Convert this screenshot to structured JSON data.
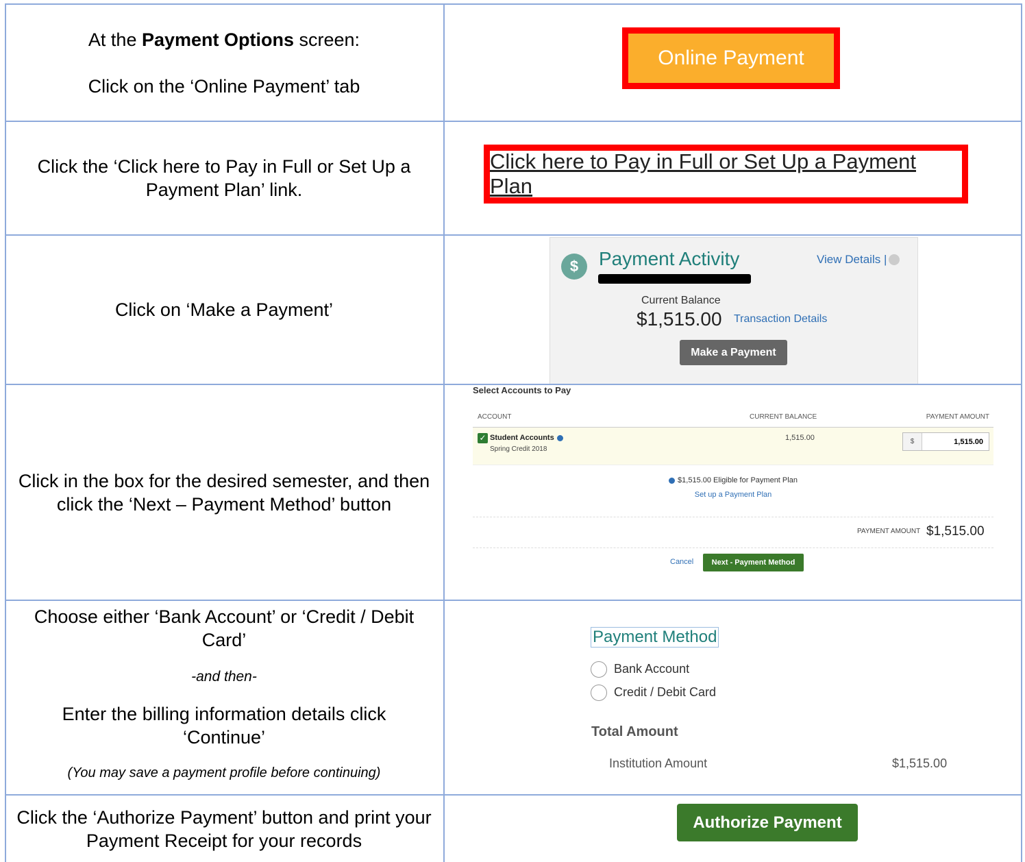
{
  "rows": [
    {
      "instruction_prefix": "At the ",
      "instruction_bold": "Payment Options",
      "instruction_suffix": " screen:",
      "instruction_line2": "Click on the ‘Online Payment’ tab",
      "button_label": "Online Payment"
    },
    {
      "instruction": "Click the ‘Click here to Pay in Full or Set Up a Payment Plan’ link.",
      "link_text": "Click here to Pay in Full or Set Up a Payment Plan"
    },
    {
      "instruction": "Click on ‘Make a Payment’",
      "panel": {
        "icon": "$",
        "title": "Payment Activity",
        "view_details": "View Details |",
        "balance_label": "Current Balance",
        "balance_value": "$1,515.00",
        "transaction_details": "Transaction Details",
        "make_payment": "Make a Payment"
      }
    },
    {
      "instruction": "Click in the box for the desired semester, and then click the ‘Next – Payment Method’ button",
      "panel": {
        "title": "Select Accounts to Pay",
        "headers": [
          "ACCOUNT",
          "CURRENT BALANCE",
          "PAYMENT AMOUNT"
        ],
        "account_name": "Student Accounts",
        "account_sub": "Spring Credit 2018",
        "account_balance": "1,515.00",
        "currency": "$",
        "amount": "1,515.00",
        "eligible": "$1,515.00 Eligible for Payment Plan",
        "setup_plan": "Set up a Payment Plan",
        "payment_amount_label": "PAYMENT AMOUNT",
        "payment_amount_value": "$1,515.00",
        "cancel": "Cancel",
        "next": "Next - Payment Method"
      }
    },
    {
      "instruction_1": "Choose either ‘Bank Account’ or ‘Credit / Debit Card’",
      "instruction_2": "-and then-",
      "instruction_3": "Enter the billing information details click ‘Continue’",
      "instruction_4": "(You may save a payment profile before continuing)",
      "panel": {
        "title": "Payment Method",
        "option_bank": "Bank Account",
        "option_card": "Credit / Debit Card",
        "total_label": "Total Amount",
        "institution_label": "Institution Amount",
        "institution_value": "$1,515.00"
      }
    },
    {
      "instruction": "Click the ‘Authorize Payment’ button and print your Payment Receipt for your records",
      "button_label": "Authorize Payment"
    }
  ]
}
